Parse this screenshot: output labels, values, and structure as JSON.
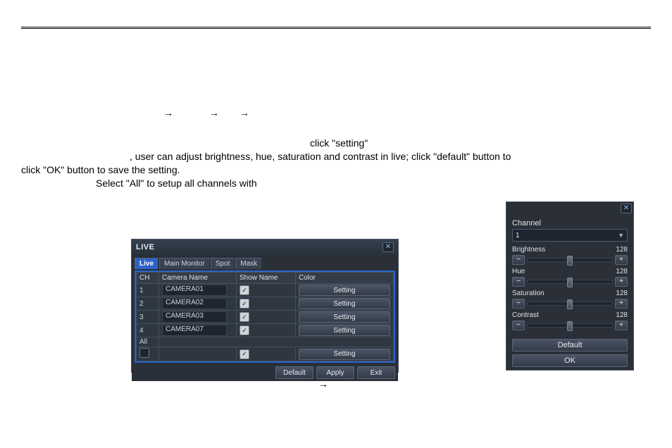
{
  "doc": {
    "arrow": "→",
    "line2a": "click \"setting\"",
    "line3": ", user can adjust brightness, hue, saturation and contrast in live; click \"default\" button to",
    "line4": "click \"OK\" button to save the setting.",
    "line5": "Select \"All\" to setup all channels with",
    "arrow_bottom": "→"
  },
  "live": {
    "title": "LIVE",
    "tabs": [
      "Live",
      "Main Monitor",
      "Spot",
      "Mask"
    ],
    "headers": {
      "ch": "CH",
      "name": "Camera Name",
      "show": "Show Name",
      "color": "Color"
    },
    "rows": [
      {
        "ch": "1",
        "name": "CAMERA01",
        "show": true,
        "btn": "Setting"
      },
      {
        "ch": "2",
        "name": "CAMERA02",
        "show": true,
        "btn": "Setting"
      },
      {
        "ch": "3",
        "name": "CAMERA03",
        "show": true,
        "btn": "Setting"
      },
      {
        "ch": "4",
        "name": "CAMERA07",
        "show": true,
        "btn": "Setting"
      }
    ],
    "all_label": "All",
    "all_btn": "Setting",
    "footer": {
      "default": "Default",
      "apply": "Apply",
      "exit": "Exit"
    }
  },
  "chan": {
    "channel_label": "Channel",
    "channel_value": "1",
    "sliders": [
      {
        "label": "Brightness",
        "value": "128"
      },
      {
        "label": "Hue",
        "value": "128"
      },
      {
        "label": "Saturation",
        "value": "128"
      },
      {
        "label": "Contrast",
        "value": "128"
      }
    ],
    "default": "Default",
    "ok": "OK"
  }
}
